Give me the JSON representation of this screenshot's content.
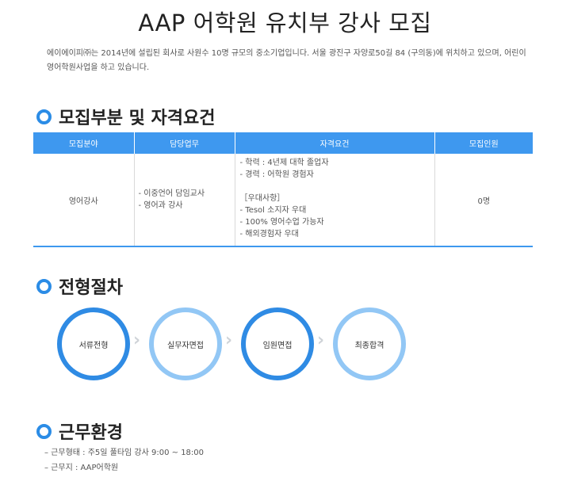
{
  "page_title": "AAP 어학원 유치부 강사 모집",
  "intro": "에이에이피㈜는 2014년에 설립된 회사로 사원수 10명 규모의 중소기업입니다. 서울 광진구 자양로50길 84 (구의동)에 위치하고 있으며, 어린이영어학원사업을 하고 있습니다.",
  "sections": {
    "recruit": "모집부분 및 자격요건",
    "process": "전형절차",
    "environment": "근무환경"
  },
  "table": {
    "headers": [
      "모집분야",
      "담당업무",
      "자격요건",
      "모집인원"
    ],
    "row": {
      "field": "영어강사",
      "duties": [
        "- 이중언어 담임교사",
        "- 영어과 강사"
      ],
      "requirements": [
        "- 학력 : 4년제 대학 졸업자",
        "- 경력 : 어학원 경험자"
      ],
      "preferred_title": "［우대사항］",
      "preferred": [
        "- Tesol 소지자 우대",
        "- 100% 영어수업 가능자",
        "- 해외경험자 우대"
      ],
      "count": "0명"
    }
  },
  "steps": [
    "서류전형",
    "실무자면접",
    "임원면접",
    "최종합격"
  ],
  "arrow_glyph": "›",
  "environment": [
    "– 근무형태 : 주5일 풀타임 강사 9:00 ~ 18:00",
    "– 근무지 : AAP어학원"
  ],
  "colors": {
    "accent": "#2f8be4",
    "accent_light": "#92c7f5",
    "header_bg": "#3e98ef"
  }
}
